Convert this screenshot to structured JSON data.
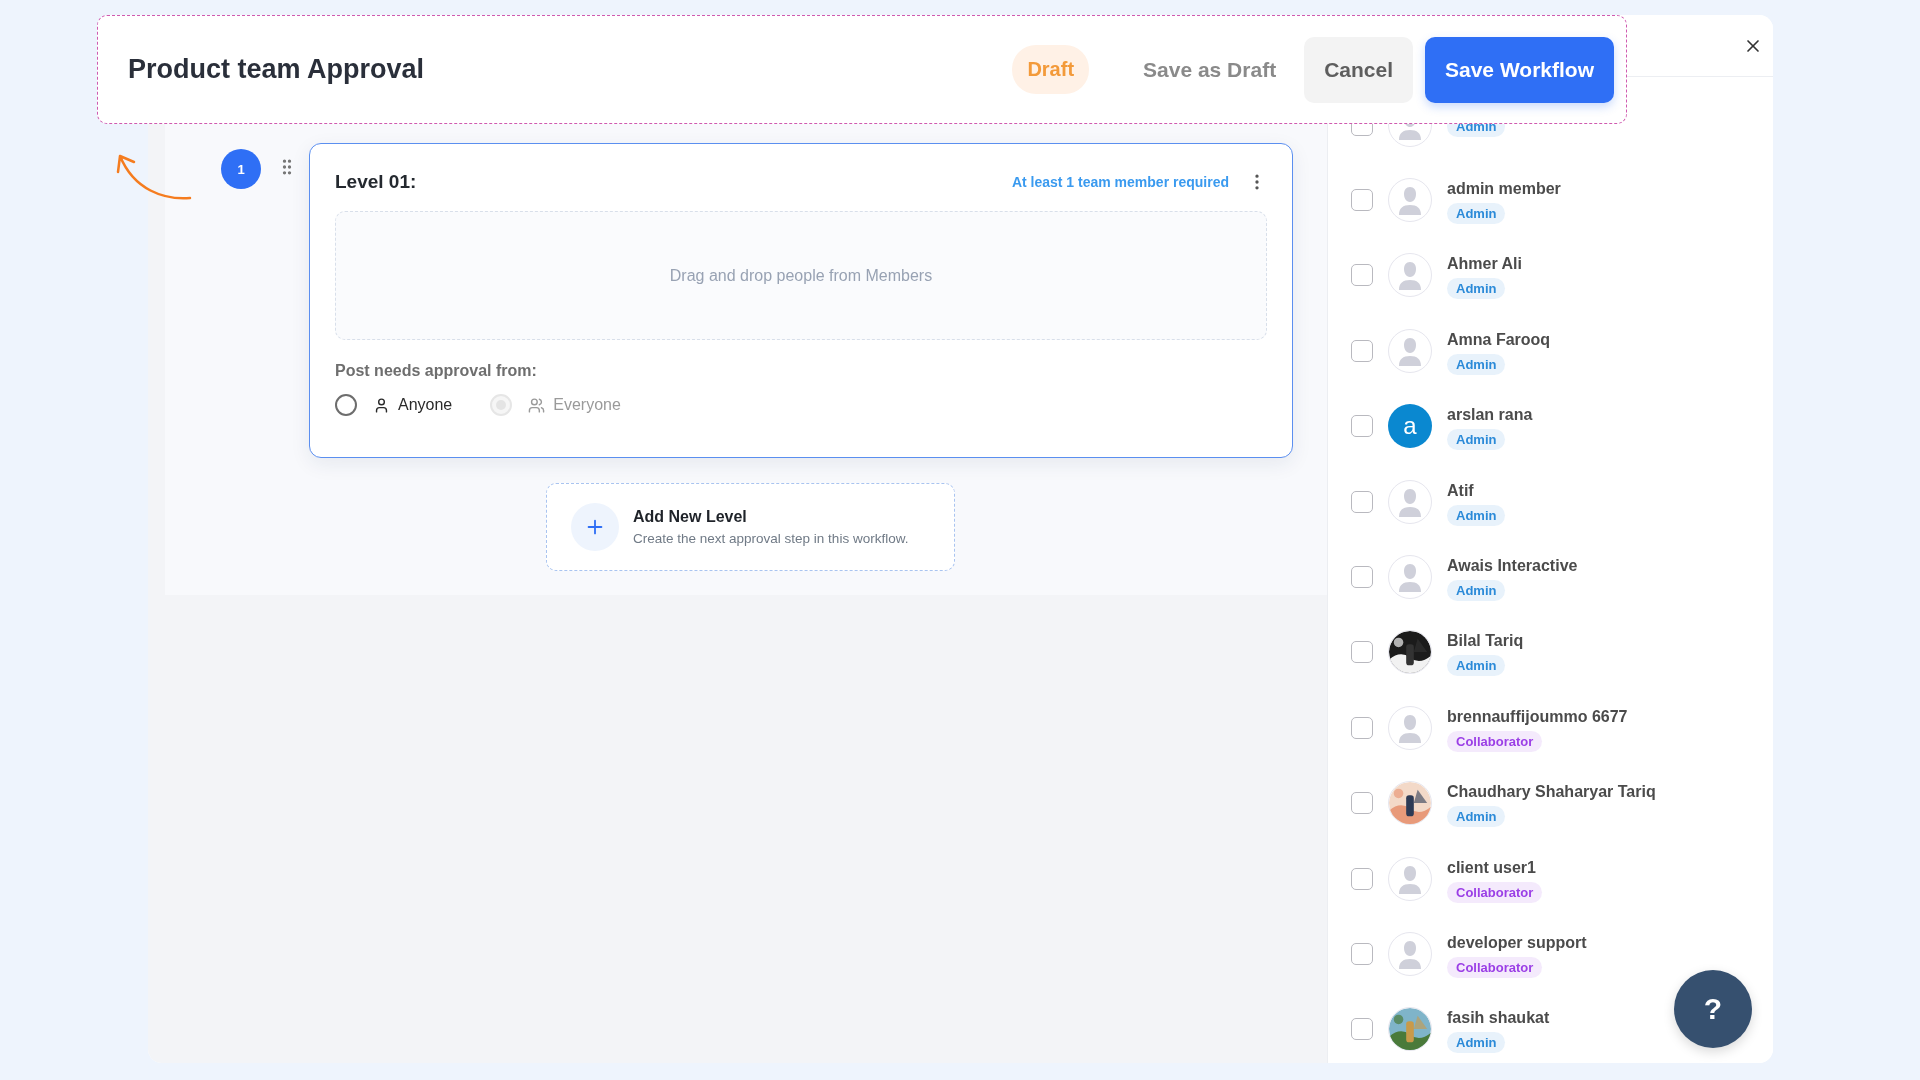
{
  "header": {
    "title": "Product team Approval",
    "status": "Draft",
    "buttons": [
      {
        "label": "Save as Draft",
        "kind": "text"
      },
      {
        "label": "Cancel",
        "kind": "secondary"
      },
      {
        "label": "Save Workflow",
        "kind": "primary"
      }
    ]
  },
  "levels": [
    {
      "step": "1",
      "title": "Level 01:",
      "requirement": "At least 1 team member required",
      "dropzone": "Drag and drop people from Members",
      "approval_label": "Post needs approval from:",
      "options": [
        {
          "label": "Anyone",
          "kind": "single",
          "selected": false,
          "disabled": false
        },
        {
          "label": "Everyone",
          "kind": "group",
          "selected": true,
          "disabled": true
        }
      ]
    }
  ],
  "add_level": {
    "title": "Add New Level",
    "subtitle": "Create the next approval step in this workflow."
  },
  "members": [
    {
      "kind": "placeholder",
      "checked": false,
      "role": {
        "label": "Admin",
        "color": "#2b8ad8"
      }
    },
    {
      "name": "admin member",
      "kind": "placeholder",
      "checked": false,
      "role": {
        "label": "Admin",
        "color": "#2b8ad8"
      }
    },
    {
      "name": "Ahmer Ali",
      "kind": "placeholder",
      "checked": false,
      "role": {
        "label": "Admin",
        "color": "#2b8ad8"
      }
    },
    {
      "name": "Amna Farooq",
      "kind": "placeholder",
      "checked": false,
      "role": {
        "label": "Admin",
        "color": "#2b8ad8"
      }
    },
    {
      "name": "arslan rana",
      "kind": "letter",
      "initial": "a",
      "checked": false,
      "role": {
        "label": "Admin",
        "color": "#2b8ad8"
      }
    },
    {
      "name": "Atif",
      "kind": "placeholder",
      "checked": false,
      "role": {
        "label": "Admin",
        "color": "#2b8ad8"
      }
    },
    {
      "name": "Awais Interactive",
      "kind": "placeholder",
      "checked": false,
      "role": {
        "label": "Admin",
        "color": "#2b8ad8"
      }
    },
    {
      "name": "Bilal Tariq",
      "kind": "picture",
      "checked": false,
      "role": {
        "label": "Admin",
        "color": "#2b8ad8"
      }
    },
    {
      "name": "brennauffijoummo 6677",
      "kind": "placeholder",
      "checked": false,
      "role": {
        "label": "Collaborator",
        "color": "#9b3fe6"
      }
    },
    {
      "name": "Chaudhary Shaharyar Tariq",
      "kind": "picture",
      "checked": false,
      "role": {
        "label": "Admin",
        "color": "#2b8ad8"
      }
    },
    {
      "name": "client user1",
      "kind": "placeholder",
      "checked": false,
      "role": {
        "label": "Collaborator",
        "color": "#9b3fe6"
      }
    },
    {
      "name": "developer support",
      "kind": "placeholder",
      "checked": false,
      "role": {
        "label": "Collaborator",
        "color": "#9b3fe6"
      }
    },
    {
      "name": "fasih shaukat",
      "kind": "picture",
      "checked": false,
      "role": {
        "label": "Admin",
        "color": "#2b8ad8"
      }
    }
  ],
  "help": {
    "label": "?"
  }
}
